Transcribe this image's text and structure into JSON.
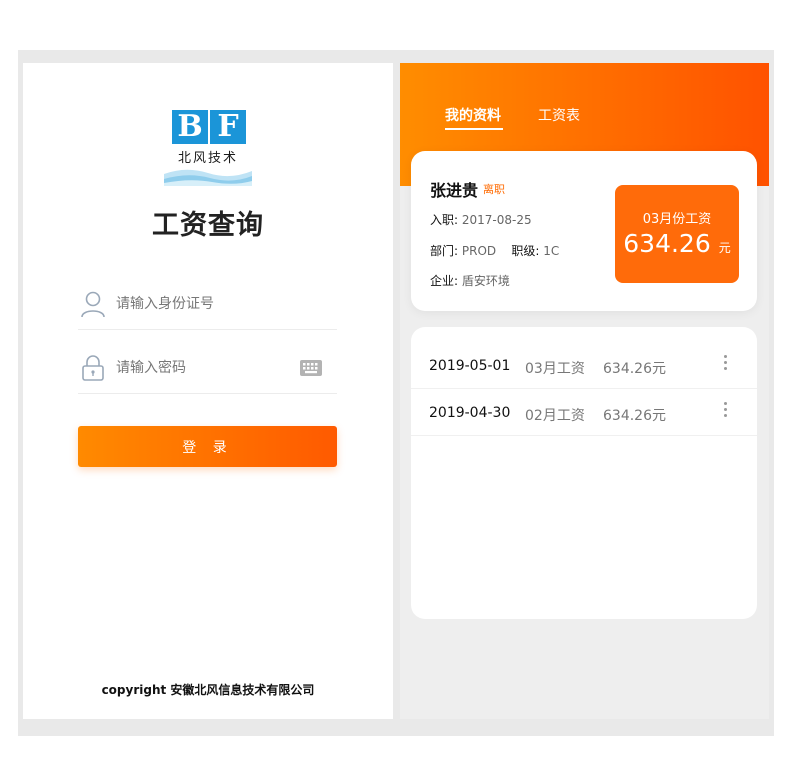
{
  "login": {
    "logo": {
      "letter1": "B",
      "letter2": "F",
      "text": "北风技术"
    },
    "title": "工资查询",
    "id_placeholder": "请输入身份证号",
    "password_placeholder": "请输入密码",
    "login_label": "登 录",
    "copyright": "copyright 安徽北风信息技术有限公司"
  },
  "profile": {
    "tabs": [
      {
        "label": "我的资料",
        "active": true
      },
      {
        "label": "工资表",
        "active": false
      }
    ],
    "employee": {
      "name": "张进贵",
      "status": "离职",
      "join_label": "入职:",
      "join_date": "2017-08-25",
      "dept_label": "部门:",
      "dept": "PROD",
      "level_label": "职级:",
      "level": "1C",
      "company_label": "企业:",
      "company": "盾安环境"
    },
    "salary": {
      "label": "03月份工资",
      "amount": "634.26",
      "unit": "元"
    },
    "records": [
      {
        "date": "2019-05-01",
        "month": "03月工资",
        "amount": "634.26元"
      },
      {
        "date": "2019-04-30",
        "month": "02月工资",
        "amount": "634.26元"
      }
    ]
  },
  "colors": {
    "accent": "#ff6a00",
    "accent_light": "#ff8a00",
    "logo_blue": "#1b95d8",
    "background": "#e9e9e9"
  },
  "icons": {
    "user": "user-icon",
    "lock": "lock-icon",
    "keyboard": "keyboard-icon",
    "more": "more-vertical-icon"
  }
}
